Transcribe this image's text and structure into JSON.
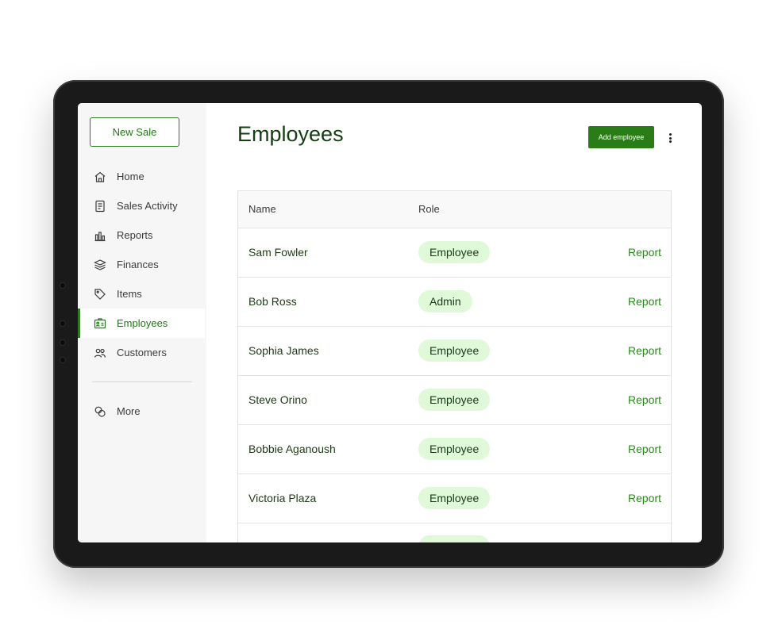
{
  "sidebar": {
    "new_sale_label": "New Sale",
    "items": [
      {
        "label": "Home",
        "icon": "home-icon"
      },
      {
        "label": "Sales Activity",
        "icon": "receipt-icon"
      },
      {
        "label": "Reports",
        "icon": "bar-chart-icon"
      },
      {
        "label": "Finances",
        "icon": "stack-icon"
      },
      {
        "label": "Items",
        "icon": "tag-icon"
      },
      {
        "label": "Employees",
        "icon": "id-badge-icon",
        "active": true
      },
      {
        "label": "Customers",
        "icon": "people-icon"
      }
    ],
    "more": {
      "label": "More",
      "icon": "overlap-circles-icon"
    }
  },
  "main": {
    "title": "Employees",
    "add_button_label": "Add employee",
    "table": {
      "headers": {
        "name": "Name",
        "role": "Role"
      },
      "rows": [
        {
          "name": "Sam Fowler",
          "role": "Employee",
          "action": "Report"
        },
        {
          "name": "Bob Ross",
          "role": "Admin",
          "action": "Report"
        },
        {
          "name": "Sophia James",
          "role": "Employee",
          "action": "Report"
        },
        {
          "name": "Steve Orino",
          "role": "Employee",
          "action": "Report"
        },
        {
          "name": "Bobbie Aganoush",
          "role": "Employee",
          "action": "Report"
        },
        {
          "name": "Victoria Plaza",
          "role": "Employee",
          "action": "Report"
        }
      ]
    }
  },
  "colors": {
    "accent": "#2a7d16",
    "pill_bg": "#dff9d9",
    "title": "#143d12",
    "device_frame": "#1a1a1a"
  }
}
